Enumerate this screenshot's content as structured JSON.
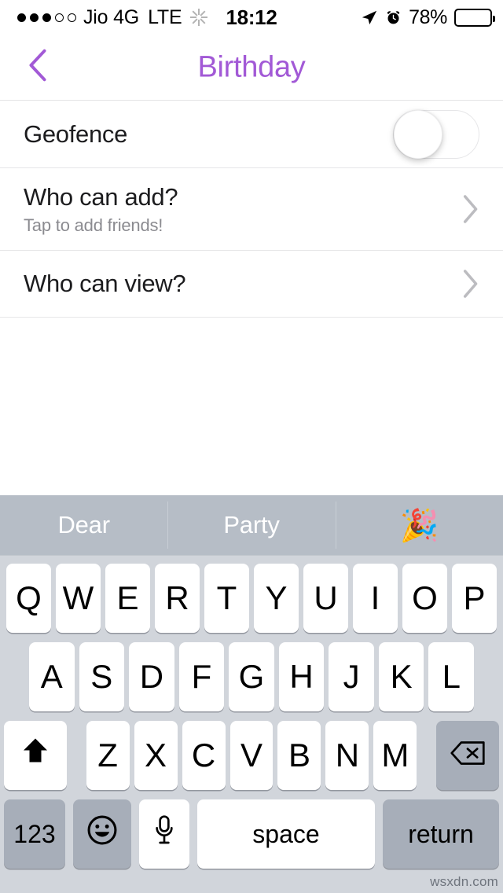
{
  "status_bar": {
    "signal_dots_filled": 3,
    "signal_dots_total": 5,
    "carrier": "Jio 4G",
    "network": "LTE",
    "activity_icon": "spinner-icon",
    "time": "18:12",
    "location_icon": "location-arrow-icon",
    "alarm_icon": "alarm-clock-icon",
    "battery_percent": "78%",
    "battery_level": 78
  },
  "nav": {
    "back_icon": "chevron-left-icon",
    "title": "Birthday",
    "accent_color": "#a259d6"
  },
  "settings": {
    "rows": [
      {
        "title": "Geofence",
        "subtitle": "",
        "accessory": "toggle",
        "toggle_on": false
      },
      {
        "title": "Who can add?",
        "subtitle": "Tap to add friends!",
        "accessory": "chevron",
        "toggle_on": null
      },
      {
        "title": "Who can view?",
        "subtitle": "",
        "accessory": "chevron",
        "toggle_on": null
      }
    ]
  },
  "keyboard": {
    "suggestions": [
      {
        "label": "Dear",
        "type": "word"
      },
      {
        "label": "Party",
        "type": "word"
      },
      {
        "label": "🎉",
        "type": "emoji"
      }
    ],
    "row1": [
      "Q",
      "W",
      "E",
      "R",
      "T",
      "Y",
      "U",
      "I",
      "O",
      "P"
    ],
    "row2": [
      "A",
      "S",
      "D",
      "F",
      "G",
      "H",
      "J",
      "K",
      "L"
    ],
    "row3": [
      "Z",
      "X",
      "C",
      "V",
      "B",
      "N",
      "M"
    ],
    "shift_icon": "shift-arrow-icon",
    "backspace_icon": "backspace-delete-icon",
    "numbers_label": "123",
    "emoji_icon": "smiley-face-icon",
    "dictation_icon": "microphone-icon",
    "space_label": "space",
    "return_label": "return",
    "background_color": "#d1d5db",
    "key_color": "#ffffff",
    "dark_key_color": "#a7aeb9",
    "suggestion_bar_color": "#b6bdc6"
  },
  "watermark": {
    "text": "wsxdn.com"
  }
}
